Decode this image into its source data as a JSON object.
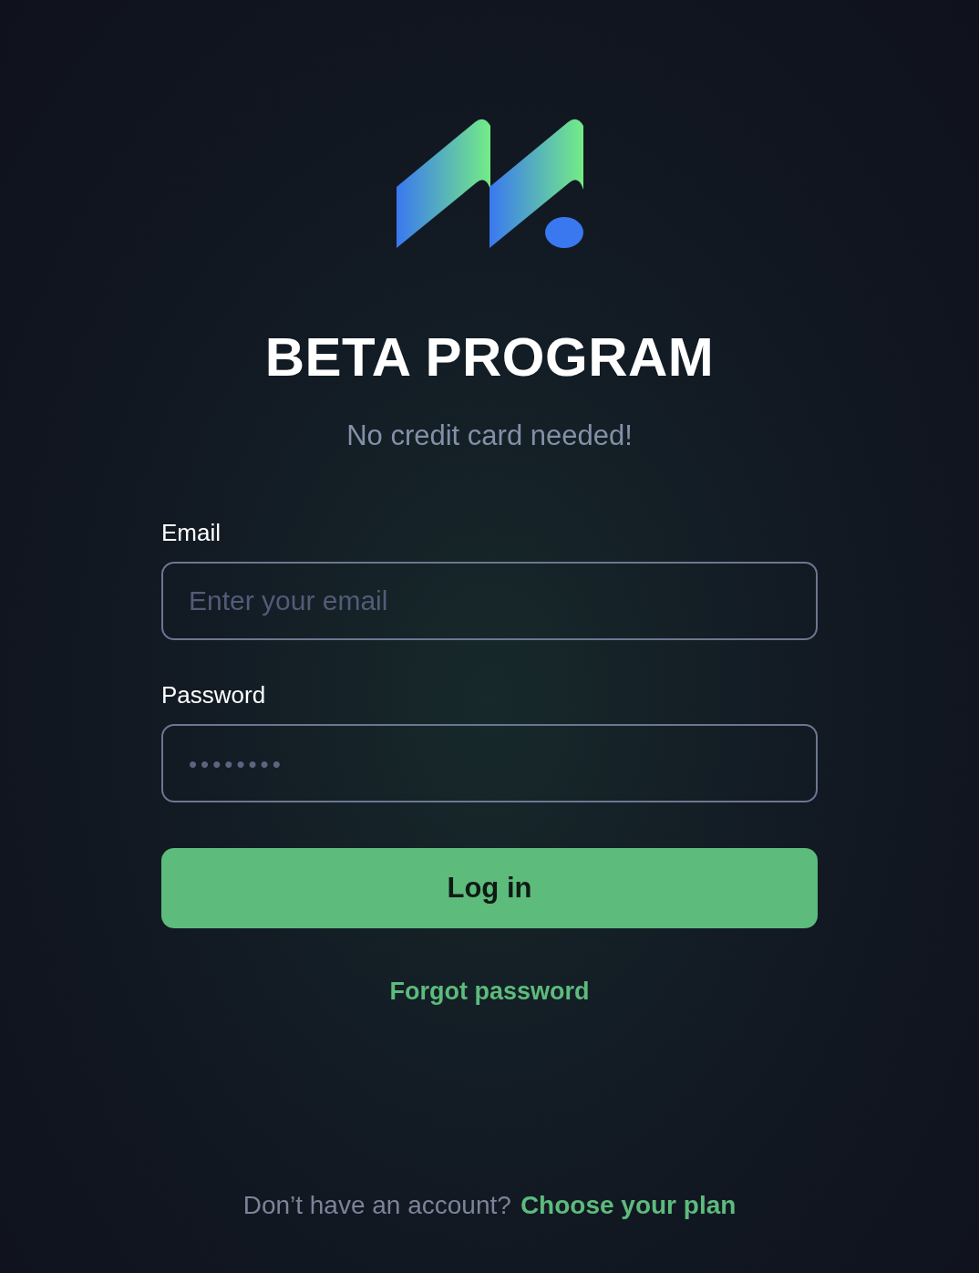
{
  "title": "BETA PROGRAM",
  "subtitle": "No credit card needed!",
  "fields": [
    {
      "label": "Email",
      "kind": "email",
      "placeholder": "Enter your email"
    },
    {
      "label": "Password",
      "kind": "password",
      "placeholder": "••••••••"
    }
  ],
  "login_button": "Log in",
  "forgot_link": "Forgot password",
  "footer": {
    "text": "Don’t have an account?",
    "link": "Choose your plan"
  }
}
